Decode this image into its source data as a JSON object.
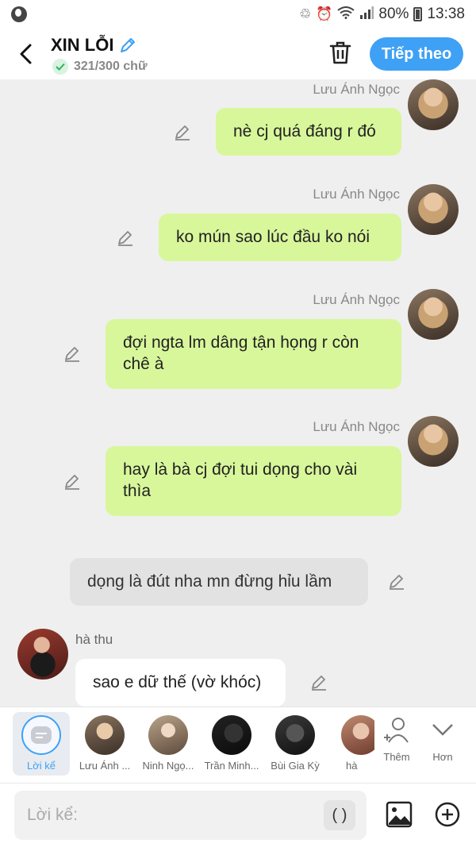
{
  "status_bar": {
    "battery": "80%",
    "time": "13:38"
  },
  "header": {
    "title": "XIN LỖI",
    "word_count": "321/300 chữ",
    "next_label": "Tiếp theo"
  },
  "messages": [
    {
      "sender": "Lưu Ánh Ngọc",
      "lines": [
        "nè cj quá đáng r đó"
      ]
    },
    {
      "sender": "Lưu Ánh Ngọc",
      "lines": [
        "ko mún sao lúc đầu ko nói"
      ]
    },
    {
      "sender": "Lưu Ánh Ngọc",
      "lines": [
        "đợi ngta lm dâng tận họng r còn",
        "chê à"
      ]
    },
    {
      "sender": "Lưu Ánh Ngọc",
      "lines": [
        "hay là bà cj đợi tui dọng cho vài",
        "thìa"
      ]
    }
  ],
  "narration": {
    "text": "dọng là đút nha mn đừng hỉu lầm"
  },
  "incoming": {
    "sender": "hà thu",
    "text": "sao e dữ thế (vờ khóc)"
  },
  "characters": [
    {
      "label": "Lời kể"
    },
    {
      "label": "Lưu Ánh ..."
    },
    {
      "label": "Ninh Ngọ..."
    },
    {
      "label": "Trần Minh..."
    },
    {
      "label": "Bùi Gia Kỳ"
    },
    {
      "label": "hà"
    }
  ],
  "char_controls": {
    "add_label": "Thêm",
    "more_label": "Hơn"
  },
  "input": {
    "placeholder": "Lời kể:",
    "paren_label": "( )"
  },
  "colors": {
    "accent": "#3ea1f5",
    "bubble_green": "#d8f79b",
    "background": "#efefef"
  }
}
